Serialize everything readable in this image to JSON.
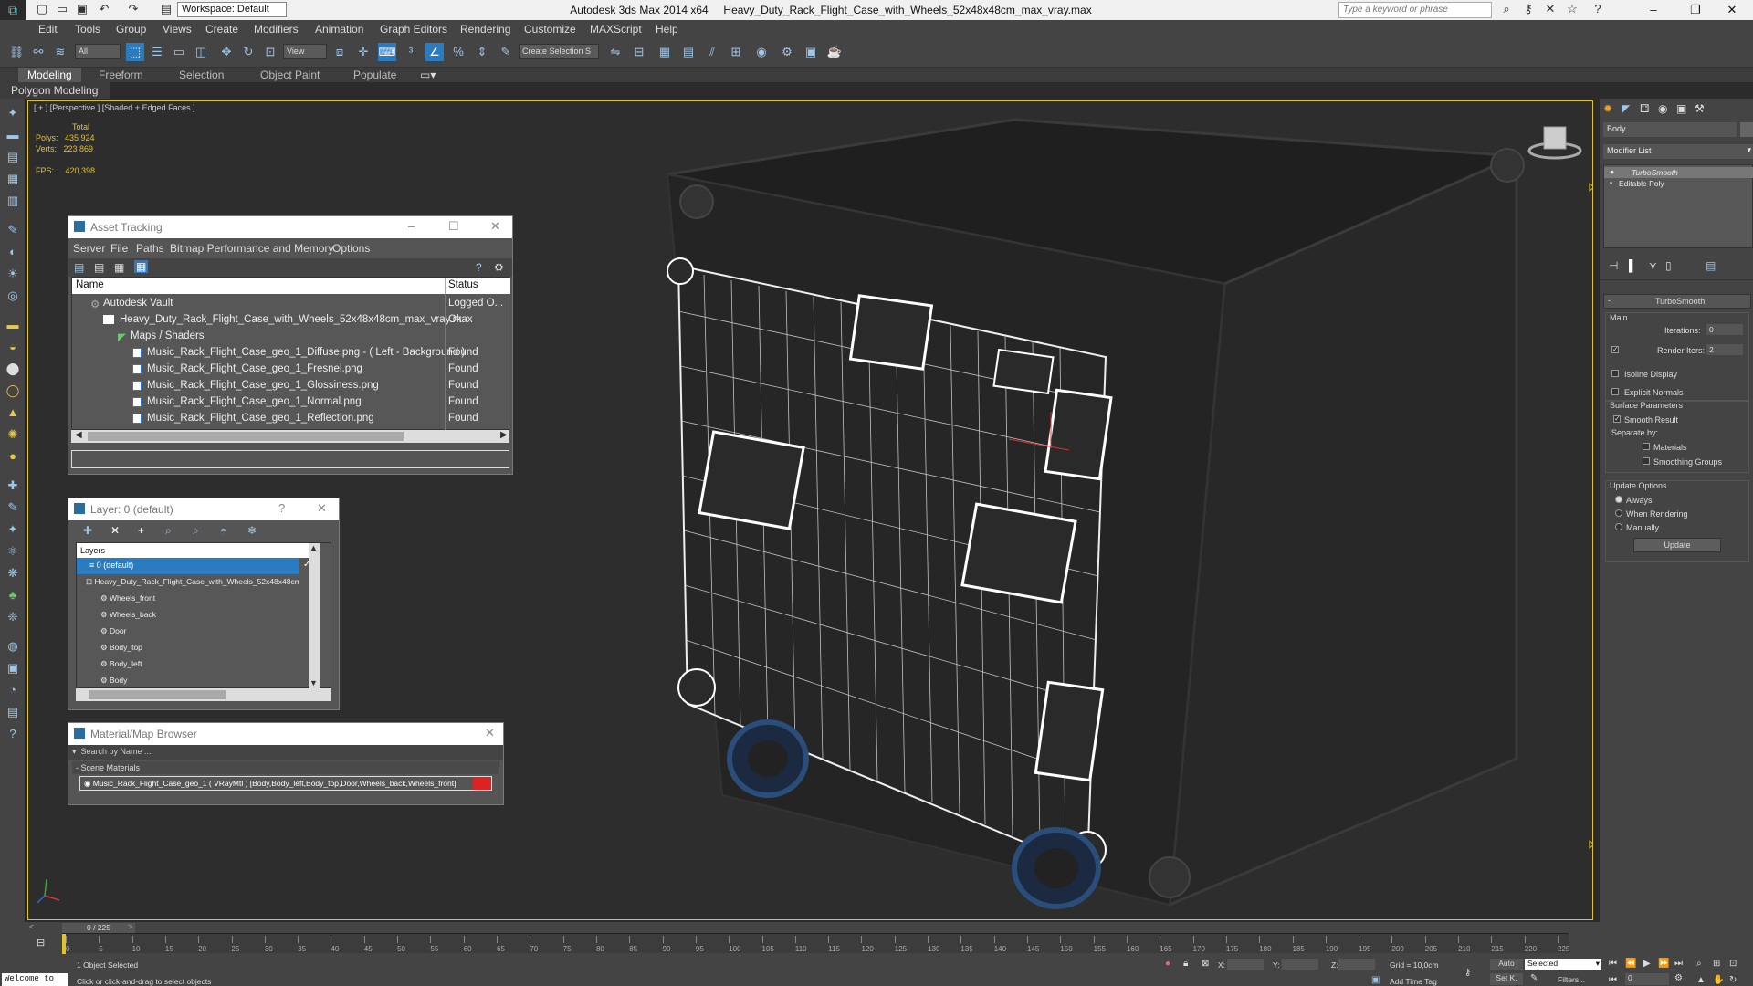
{
  "title_bar": {
    "app_title": "Autodesk 3ds Max  2014 x64",
    "file_title": "Heavy_Duty_Rack_Flight_Case_with_Wheels_52x48x48cm_max_vray.max",
    "workspace": "Workspace: Default",
    "search_placeholder": "Type a keyword or phrase"
  },
  "menu": [
    "Edit",
    "Tools",
    "Group",
    "Views",
    "Create",
    "Modifiers",
    "Animation",
    "Graph Editors",
    "Rendering",
    "Customize",
    "MAXScript",
    "Help"
  ],
  "toolbar": {
    "selection_filter": "All",
    "view_dropdown": "View",
    "named_selection": "Create Selection S"
  },
  "ribbon": {
    "tabs": [
      "Modeling",
      "Freeform",
      "Selection",
      "Object Paint",
      "Populate"
    ],
    "sub": "Polygon Modeling"
  },
  "viewport": {
    "label": "[ + ] [Perspective ] [Shaded + Edged Faces ]",
    "stats_total": "Total",
    "polys_label": "Polys:",
    "polys_value": "435 924",
    "verts_label": "Verts:",
    "verts_value": "223 869",
    "fps_label": "FPS:",
    "fps_value": "420,398"
  },
  "asset_tracking": {
    "title": "Asset Tracking",
    "menu": [
      "Server",
      "File",
      "Paths",
      "Bitmap Performance and Memory",
      "Options"
    ],
    "col_name": "Name",
    "col_status": "Status",
    "rows": [
      {
        "name": "Autodesk Vault",
        "status": "Logged O..."
      },
      {
        "name": "Heavy_Duty_Rack_Flight_Case_with_Wheels_52x48x48cm_max_vray.max",
        "status": "Ok"
      },
      {
        "name": "Maps / Shaders",
        "status": ""
      },
      {
        "name": "Music_Rack_Flight_Case_geo_1_Diffuse.png - ( Left - Background )",
        "status": "Found"
      },
      {
        "name": "Music_Rack_Flight_Case_geo_1_Fresnel.png",
        "status": "Found"
      },
      {
        "name": "Music_Rack_Flight_Case_geo_1_Glossiness.png",
        "status": "Found"
      },
      {
        "name": "Music_Rack_Flight_Case_geo_1_Normal.png",
        "status": "Found"
      },
      {
        "name": "Music_Rack_Flight_Case_geo_1_Reflection.png",
        "status": "Found"
      }
    ]
  },
  "layer": {
    "title": "Layer: 0 (default)",
    "header": "Layers",
    "items": [
      "0 (default)",
      "Heavy_Duty_Rack_Flight_Case_with_Wheels_52x48x48cm",
      "Wheels_front",
      "Wheels_back",
      "Door",
      "Body_top",
      "Body_left",
      "Body"
    ]
  },
  "material_browser": {
    "title": "Material/Map Browser",
    "search_placeholder": "Search by Name ...",
    "section": "- Scene Materials",
    "material": "Music_Rack_Flight_Case_geo_1 ( VRayMtl ) [Body,Body_left,Body_top,Door,Wheels_back,Wheels_front]"
  },
  "right_panel": {
    "object_name": "Body",
    "modifier_list": "Modifier List",
    "stack": [
      "TurboSmooth",
      "Editable Poly"
    ],
    "rollout_title": "TurboSmooth",
    "main": "Main",
    "iterations_label": "Iterations:",
    "iterations_value": "0",
    "render_iters_label": "Render Iters:",
    "render_iters_value": "2",
    "isoline": "Isoline Display",
    "explicit": "Explicit Normals",
    "surface": "Surface Parameters",
    "smooth_result": "Smooth Result",
    "separate_by": "Separate by:",
    "materials": "Materials",
    "smoothing_groups": "Smoothing Groups",
    "update_options": "Update Options",
    "always": "Always",
    "when_rendering": "When Rendering",
    "manually": "Manually",
    "update_btn": "Update"
  },
  "status": {
    "frame": "0 / 225",
    "welcome": "Welcome to",
    "selected": "1 Object Selected",
    "hint": "Click or click-and-drag to select objects",
    "x_label": "X:",
    "y_label": "Y:",
    "z_label": "Z:",
    "grid": "Grid = 10,0cm",
    "add_time_tag": "Add Time Tag",
    "auto": "Auto",
    "set_key": "Set K.",
    "selected_dropdown": "Selected",
    "filters": "Filters...",
    "frame_field": "0"
  },
  "timeline_ticks": [
    "0",
    "5",
    "10",
    "15",
    "20",
    "25",
    "30",
    "35",
    "40",
    "45",
    "50",
    "55",
    "60",
    "65",
    "70",
    "75",
    "80",
    "85",
    "90",
    "95",
    "100",
    "105",
    "110",
    "115",
    "120",
    "125",
    "130",
    "135",
    "140",
    "145",
    "150",
    "155",
    "160",
    "165",
    "170",
    "175",
    "180",
    "185",
    "190",
    "195",
    "200",
    "205",
    "210",
    "215",
    "220",
    "225"
  ]
}
